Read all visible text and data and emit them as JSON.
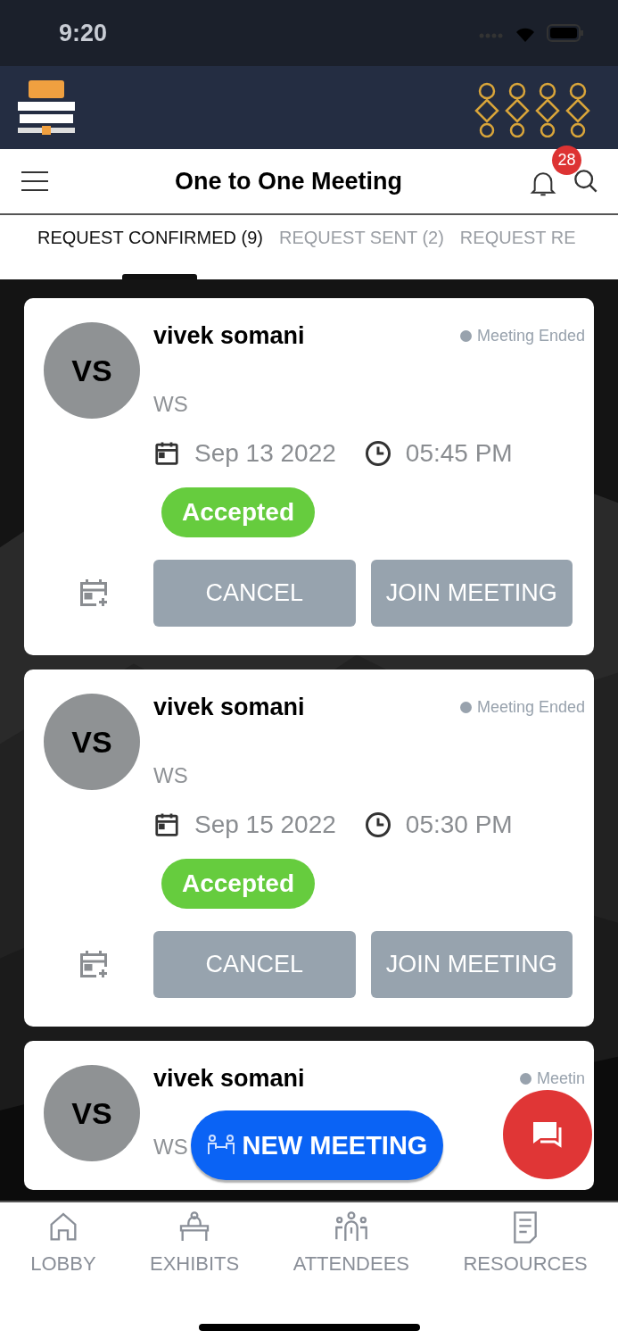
{
  "status_bar": {
    "time": "9:20"
  },
  "header": {
    "title": "One to One Meeting",
    "notification_count": "28"
  },
  "tabs": [
    {
      "label": "REQUEST CONFIRMED (9)",
      "selected": true
    },
    {
      "label": "REQUEST SENT (2)",
      "selected": false
    },
    {
      "label": "REQUEST RE",
      "selected": false
    }
  ],
  "meetings": [
    {
      "initials": "VS",
      "name": "vivek somani",
      "status": "Meeting Ended",
      "company": "WS",
      "date": "Sep 13 2022",
      "time": "05:45 PM",
      "badge": "Accepted",
      "buttons": [
        "CANCEL",
        "JOIN MEETING"
      ]
    },
    {
      "initials": "VS",
      "name": "vivek somani",
      "status": "Meeting Ended",
      "company": "WS",
      "date": "Sep 15 2022",
      "time": "05:30 PM",
      "badge": "Accepted",
      "buttons": [
        "CANCEL",
        "JOIN MEETING"
      ]
    },
    {
      "initials": "VS",
      "name": "vivek somani",
      "status": "Meetin",
      "company": "WS"
    }
  ],
  "new_meeting_button": "NEW MEETING",
  "bottom_nav": [
    {
      "label": "LOBBY",
      "kind": "home"
    },
    {
      "label": "EXHIBITS",
      "kind": "exhibits"
    },
    {
      "label": "ATTENDEES",
      "kind": "attendees"
    },
    {
      "label": "RESOURCES",
      "kind": "resources"
    }
  ]
}
